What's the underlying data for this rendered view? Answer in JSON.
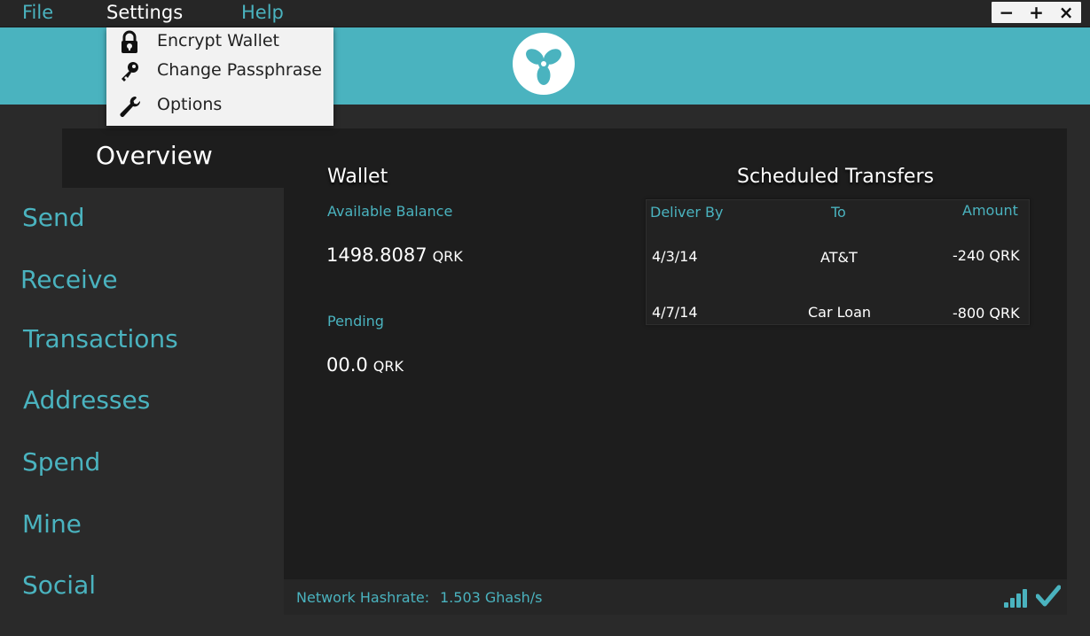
{
  "menubar": {
    "file": "File",
    "settings": "Settings",
    "help": "Help"
  },
  "window_controls": {
    "minimize": "−",
    "maximize": "+",
    "close": "×"
  },
  "settings_menu": {
    "items": [
      {
        "label": "Encrypt Wallet",
        "icon": "lock-icon"
      },
      {
        "label": "Change Passphrase",
        "icon": "key-icon"
      },
      {
        "label": "Options",
        "icon": "wrench-icon"
      }
    ]
  },
  "sidebar": {
    "active": "Overview",
    "items": [
      "Send",
      "Receive",
      "Transactions",
      "Addresses",
      "Spend",
      "Mine",
      "Social"
    ]
  },
  "wallet": {
    "title": "Wallet",
    "available_label": "Available Balance",
    "available_value": "1498.8087",
    "available_unit": "QRK",
    "pending_label": "Pending",
    "pending_value": "00.0",
    "pending_unit": "QRK"
  },
  "scheduled": {
    "title": "Scheduled Transfers",
    "headers": {
      "deliver_by": "Deliver By",
      "to": "To",
      "amount": "Amount"
    },
    "rows": [
      {
        "date": "4/3/14",
        "to": "AT&T",
        "amount": "-240 QRK"
      },
      {
        "date": "4/7/14",
        "to": "Car Loan",
        "amount": "-800 QRK"
      }
    ]
  },
  "status": {
    "hashrate_label": "Network Hashrate:",
    "hashrate_value": "1.503 Ghash/s"
  },
  "colors": {
    "accent": "#4ab3bf",
    "background": "#2a2a2a",
    "panel": "#1d1d1d"
  }
}
